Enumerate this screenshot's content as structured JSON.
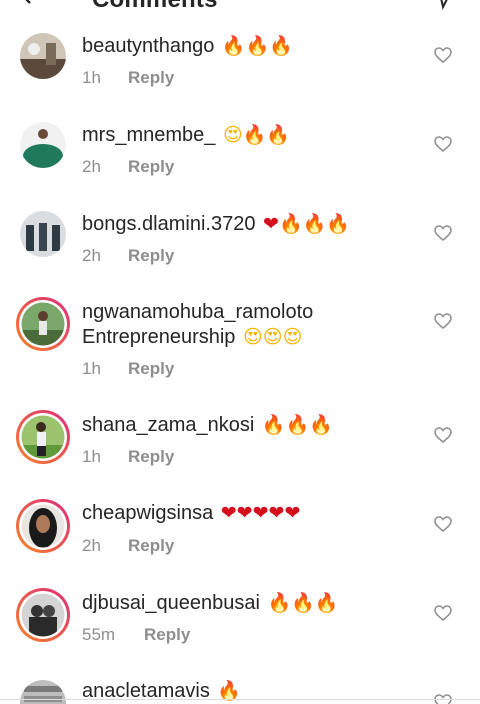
{
  "header": {
    "title": "Comments"
  },
  "comments": [
    {
      "username": "beautynthango",
      "emoji": "🔥🔥🔥",
      "text": "",
      "time": "1h",
      "reply": "Reply"
    },
    {
      "username": "mrs_mnembe_",
      "emoji": "😍🔥🔥",
      "text": "",
      "time": "2h",
      "reply": "Reply"
    },
    {
      "username": "bongs.dlamini.3720",
      "emoji": "❤🔥🔥🔥",
      "text": "",
      "time": "2h",
      "reply": "Reply"
    },
    {
      "username": "ngwanamohuba_ramoloto",
      "emoji": "😍😍😍",
      "text": "Entrepreneurship",
      "time": "1h",
      "reply": "Reply"
    },
    {
      "username": "shana_zama_nkosi",
      "emoji": "🔥🔥🔥",
      "text": "",
      "time": "1h",
      "reply": "Reply"
    },
    {
      "username": "cheapwigsinsa",
      "emoji": "❤❤❤❤❤",
      "text": "",
      "time": "2h",
      "reply": "Reply"
    },
    {
      "username": "djbusai_queenbusai",
      "emoji": "🔥🔥🔥",
      "text": "",
      "time": "55m",
      "reply": "Reply"
    },
    {
      "username": "anacletamavis",
      "emoji": "🔥",
      "text": "",
      "time": "",
      "reply": ""
    }
  ],
  "colors": {
    "ring_start": "#f58529",
    "ring_end": "#dd2a7b",
    "meta": "#8e8e8e"
  }
}
